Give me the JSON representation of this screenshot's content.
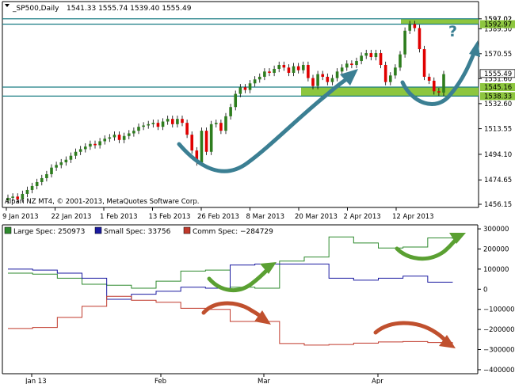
{
  "window": {
    "header_symbol": "_SP500,Daily",
    "header_ohlc": "1541.33 1555.74 1539.40 1555.49",
    "copyright": "Alpari NZ MT4, © 2001-2013, MetaQuotes Software Corp."
  },
  "colors": {
    "bull": "#2e7d1e",
    "bear": "#e00000",
    "zone_fill": "#8dc63f",
    "zone_line": "#1b7d84",
    "arrow_blue": "#3b7f93",
    "arrow_green": "#5aa032",
    "arrow_red": "#c0502e",
    "large": "#2e8a2e",
    "small": "#1a1aa0",
    "comm": "#c0392b"
  },
  "annotation": {
    "question_mark": "?"
  },
  "chart_data": [
    {
      "type": "candlestick",
      "x_labels": [
        "9 Jan 2013",
        "22 Jan 2013",
        "1 Feb 2013",
        "13 Feb 2013",
        "26 Feb 2013",
        "8 Mar 2013",
        "20 Mar 2013",
        "2 Apr 2013",
        "12 Apr 2013"
      ],
      "y_ticks": [
        "1597.02",
        "1589.50",
        "1570.55",
        "1551.60",
        "1532.60",
        "1513.55",
        "1494.10",
        "1474.65",
        "1456.15"
      ],
      "y_tick_values": [
        1597.02,
        1589.5,
        1570.55,
        1551.6,
        1532.6,
        1513.55,
        1494.1,
        1474.65,
        1456.15
      ],
      "ylim": [
        1456.15,
        1600.5
      ],
      "price_labels": [
        {
          "text": "1597.02",
          "value": 1597.02,
          "style": "plain"
        },
        {
          "text": "1592.97",
          "value": 1592.97,
          "style": "zone"
        },
        {
          "text": "1555.49",
          "value": 1555.49,
          "style": "current"
        },
        {
          "text": "1545.16",
          "value": 1545.16,
          "style": "zone"
        },
        {
          "text": "1538.33",
          "value": 1538.33,
          "style": "zone"
        }
      ],
      "zones": [
        {
          "low": 1592.97,
          "high": 1597.02
        },
        {
          "low": 1538.33,
          "high": 1545.16
        }
      ],
      "closes": [
        1461,
        1462,
        1460,
        1464,
        1467,
        1470,
        1473,
        1476,
        1479,
        1484,
        1486,
        1488,
        1490,
        1493,
        1496,
        1498,
        1500,
        1502,
        1501,
        1504,
        1506,
        1507,
        1509,
        1505,
        1508,
        1510,
        1512,
        1515,
        1516,
        1517,
        1518,
        1515,
        1519,
        1521,
        1517,
        1521,
        1518,
        1509,
        1497,
        1488,
        1512,
        1496,
        1517,
        1518,
        1512,
        1523,
        1530,
        1540,
        1545,
        1543,
        1548,
        1551,
        1553,
        1557,
        1556,
        1559,
        1562,
        1560,
        1556,
        1561,
        1558,
        1562,
        1552,
        1546,
        1555,
        1553,
        1549,
        1552,
        1557,
        1560,
        1563,
        1562,
        1565,
        1569,
        1571,
        1568,
        1571,
        1562,
        1549,
        1554,
        1560,
        1570,
        1588,
        1593,
        1590,
        1574,
        1553,
        1550,
        1542,
        1541,
        1555
      ]
    },
    {
      "type": "line",
      "x_labels": [
        "Jan 13",
        "Feb",
        "Mar",
        "Apr"
      ],
      "y_ticks": [
        "300000",
        "200000",
        "100000",
        "0",
        "−100000",
        "−200000",
        "−300000",
        "−400000"
      ],
      "y_tick_values": [
        300000,
        200000,
        100000,
        0,
        -100000,
        -200000,
        -300000,
        -400000
      ],
      "ylim": [
        -420000,
        320000
      ],
      "legend": {
        "large": "Large Spec: 250973",
        "small": "Small Spec: 33756",
        "comm": "Comm Spec: −284729"
      },
      "series": [
        {
          "name": "Large Spec",
          "values": [
            80000,
            75000,
            55000,
            25000,
            20000,
            5000,
            40000,
            90000,
            95000,
            10000,
            5000,
            140000,
            160000,
            260000,
            230000,
            205000,
            210000,
            255000,
            250973
          ]
        },
        {
          "name": "Small Spec",
          "values": [
            100000,
            95000,
            80000,
            55000,
            -50000,
            -25000,
            -10000,
            10000,
            5000,
            120000,
            125000,
            125000,
            125000,
            55000,
            45000,
            55000,
            65000,
            35000,
            33756
          ]
        },
        {
          "name": "Comm Spec",
          "values": [
            -195000,
            -190000,
            -140000,
            -85000,
            -35000,
            -55000,
            -65000,
            -95000,
            -100000,
            -160000,
            -160000,
            -270000,
            -278000,
            -275000,
            -268000,
            -262000,
            -260000,
            -265000,
            -284729
          ]
        }
      ]
    }
  ]
}
